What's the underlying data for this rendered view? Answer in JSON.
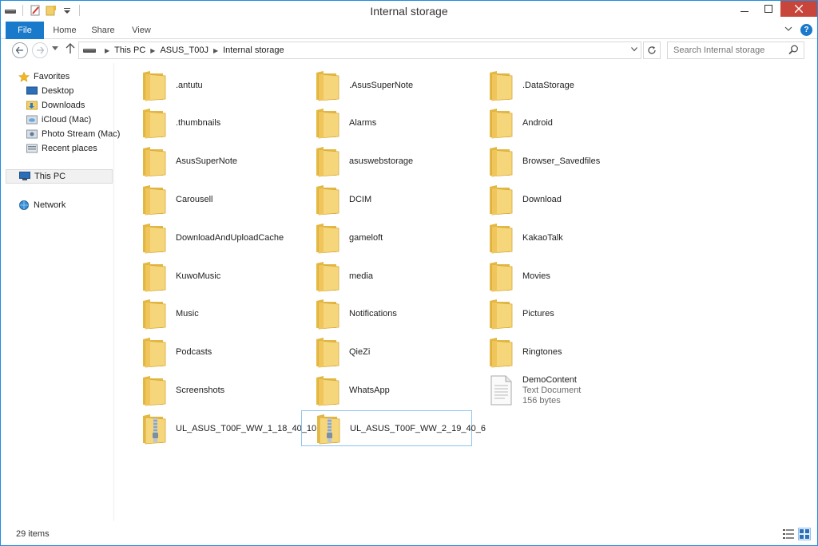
{
  "window": {
    "title": "Internal storage"
  },
  "ribbon": {
    "tabs": [
      {
        "label": "File"
      },
      {
        "label": "Home"
      },
      {
        "label": "Share"
      },
      {
        "label": "View"
      }
    ],
    "help": "?"
  },
  "address": {
    "breadcrumbs": [
      "This PC",
      "ASUS_T00J",
      "Internal storage"
    ]
  },
  "search": {
    "placeholder": "Search Internal storage"
  },
  "navpane": {
    "favorites": "Favorites",
    "favorite_items": [
      {
        "label": "Desktop",
        "icon": "desktop-icon"
      },
      {
        "label": "Downloads",
        "icon": "downloads-icon"
      },
      {
        "label": "iCloud (Mac)",
        "icon": "cloud-icon"
      },
      {
        "label": "Photo Stream (Mac)",
        "icon": "photos-icon"
      },
      {
        "label": "Recent places",
        "icon": "recent-icon"
      }
    ],
    "this_pc": "This PC",
    "network": "Network"
  },
  "items": [
    {
      "name": ".antutu",
      "type": "folder"
    },
    {
      "name": ".AsusSuperNote",
      "type": "folder"
    },
    {
      "name": ".DataStorage",
      "type": "folder"
    },
    {
      "name": ".thumbnails",
      "type": "folder"
    },
    {
      "name": "Alarms",
      "type": "folder"
    },
    {
      "name": "Android",
      "type": "folder"
    },
    {
      "name": "AsusSuperNote",
      "type": "folder"
    },
    {
      "name": "asuswebstorage",
      "type": "folder"
    },
    {
      "name": "Browser_Savedfiles",
      "type": "folder"
    },
    {
      "name": "Carousell",
      "type": "folder"
    },
    {
      "name": "DCIM",
      "type": "folder"
    },
    {
      "name": "Download",
      "type": "folder"
    },
    {
      "name": "DownloadAndUploadCache",
      "type": "folder"
    },
    {
      "name": "gameloft",
      "type": "folder"
    },
    {
      "name": "KakaoTalk",
      "type": "folder"
    },
    {
      "name": "KuwoMusic",
      "type": "folder"
    },
    {
      "name": "media",
      "type": "folder"
    },
    {
      "name": "Movies",
      "type": "folder"
    },
    {
      "name": "Music",
      "type": "folder"
    },
    {
      "name": "Notifications",
      "type": "folder"
    },
    {
      "name": "Pictures",
      "type": "folder"
    },
    {
      "name": "Podcasts",
      "type": "folder"
    },
    {
      "name": "QieZi",
      "type": "folder"
    },
    {
      "name": "Ringtones",
      "type": "folder"
    },
    {
      "name": "Screenshots",
      "type": "folder"
    },
    {
      "name": "WhatsApp",
      "type": "folder"
    },
    {
      "name": "DemoContent",
      "type": "document",
      "kind": "Text Document",
      "size": "156 bytes"
    },
    {
      "name": "UL_ASUS_T00F_WW_1_18_40_10",
      "type": "zip"
    },
    {
      "name": "UL_ASUS_T00F_WW_2_19_40_6",
      "type": "zip",
      "selected": true
    }
  ],
  "status": {
    "count": "29 items"
  },
  "colors": {
    "accent": "#1979ca",
    "close": "#c7453a",
    "folder": "#f1cf6a"
  }
}
